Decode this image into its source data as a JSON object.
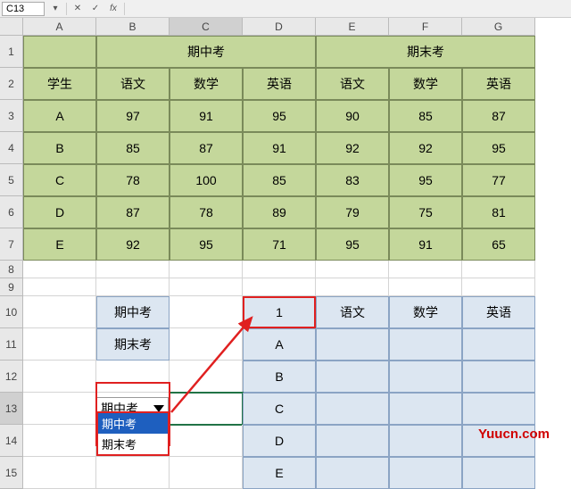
{
  "namebox": "C13",
  "fxlabel": "fx",
  "columns": [
    "A",
    "B",
    "C",
    "D",
    "E",
    "F",
    "G"
  ],
  "activeCol": "C",
  "activeRow": "13",
  "headers": {
    "midterm": "期中考",
    "final": "期末考",
    "student": "学生",
    "chinese": "语文",
    "math": "数学",
    "english": "英语"
  },
  "scores": [
    {
      "s": "A",
      "m": {
        "c": 97,
        "m": 91,
        "e": 95
      },
      "f": {
        "c": 90,
        "m": 85,
        "e": 87
      }
    },
    {
      "s": "B",
      "m": {
        "c": 85,
        "m": 87,
        "e": 91
      },
      "f": {
        "c": 92,
        "m": 92,
        "e": 95
      }
    },
    {
      "s": "C",
      "m": {
        "c": 78,
        "m": 100,
        "e": 85
      },
      "f": {
        "c": 83,
        "m": 95,
        "e": 77
      }
    },
    {
      "s": "D",
      "m": {
        "c": 87,
        "m": 78,
        "e": 89
      },
      "f": {
        "c": 79,
        "m": 75,
        "e": 81
      }
    },
    {
      "s": "E",
      "m": {
        "c": 92,
        "m": 95,
        "e": 71
      },
      "f": {
        "c": 95,
        "m": 91,
        "e": 65
      }
    }
  ],
  "box_b10": "期中考",
  "box_b11": "期末考",
  "dropdown_value": "期中考",
  "dropdown_options": [
    "期中考",
    "期末考"
  ],
  "dropdown_selected": "期中考",
  "result_header": "1",
  "result_subjects": [
    "语文",
    "数学",
    "英语"
  ],
  "result_students": [
    "A",
    "B",
    "C",
    "D",
    "E"
  ],
  "watermark": "Yuucn.com"
}
